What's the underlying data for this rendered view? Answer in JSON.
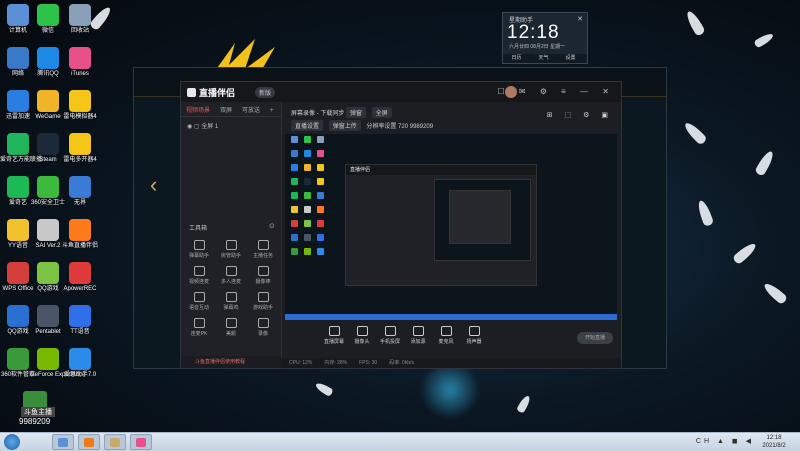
{
  "desktop_icons": [
    {
      "label": "计算机",
      "color": "#5b8fd6"
    },
    {
      "label": "微信",
      "color": "#2dc34a"
    },
    {
      "label": "回收站",
      "color": "#8aa0b8"
    },
    {
      "label": "网络",
      "color": "#3a78c8"
    },
    {
      "label": "腾讯QQ",
      "color": "#1e88e5"
    },
    {
      "label": "iTunes",
      "color": "#e8508a"
    },
    {
      "label": "迅雷加速",
      "color": "#2a7de1"
    },
    {
      "label": "WeGame",
      "color": "#f0b428"
    },
    {
      "label": "雷电模拟器4",
      "color": "#f5c518"
    },
    {
      "label": "爱奇艺万能联播",
      "color": "#20b55a"
    },
    {
      "label": "Steam",
      "color": "#1b2838"
    },
    {
      "label": "雷电多开器4",
      "color": "#f5c518"
    },
    {
      "label": "爱奇艺",
      "color": "#1db954"
    },
    {
      "label": "360安全卫士",
      "color": "#3cba3c"
    },
    {
      "label": "无界",
      "color": "#3a7bd5"
    },
    {
      "label": "YY语音",
      "color": "#f2c22e"
    },
    {
      "label": "SAI Ver.2",
      "color": "#c8c8c8"
    },
    {
      "label": "斗鱼直播伴侣",
      "color": "#ff7a1a"
    },
    {
      "label": "WPS Office",
      "color": "#d43f3a"
    },
    {
      "label": "QQ游戏",
      "color": "#7cc343"
    },
    {
      "label": "ApowerREC",
      "color": "#e03a3a"
    },
    {
      "label": "QQ游戏",
      "color": "#2a6fd1"
    },
    {
      "label": "Pentablet",
      "color": "#4a5568"
    },
    {
      "label": "TT语音",
      "color": "#2f6fea"
    },
    {
      "label": "360软件管家",
      "color": "#3a9a3a"
    },
    {
      "label": "GeForce Experience",
      "color": "#76b900"
    },
    {
      "label": "爱思助手7.0",
      "color": "#2b8be8"
    }
  ],
  "clock_widget": {
    "tag": "星期助手",
    "time": "12:18",
    "sub": "六月廿四  08月2日  星期一",
    "bottom": [
      "日历",
      "天气",
      "设置"
    ]
  },
  "app": {
    "name": "直播伴侣",
    "badge": "新版",
    "tabs": [
      "视频场景",
      "双屏",
      "可放送"
    ],
    "scene_item": "全屏 1",
    "tools_title": "工具箱",
    "tools": [
      "弹幕助手",
      "房管助手",
      "主播任务",
      "视频连麦",
      "多人连麦",
      "摄像棒",
      "语音互动",
      "弹幕鸡",
      "游戏助手",
      "连麦PK",
      "美颜",
      "录像"
    ],
    "left_footer": "斗鱼直播伴侣使用教程",
    "toolbar_row1": [
      "屏幕录像 - 下载同步",
      "弹窗",
      "全屏"
    ],
    "toolbar_row2": [
      "直播设置",
      "弹窗上传",
      "分辨率设置 720",
      "9989209"
    ],
    "bottom_buttons": [
      "直播屏幕",
      "摄像头",
      "手机投屏",
      "添加源",
      "麦克风",
      "扬声器"
    ],
    "start_live": "开始直播",
    "status": [
      "CPU: 12%",
      "内存: 28%",
      "FPS: 30",
      "码率: 0kb/s"
    ]
  },
  "nested_app_title": "直播伴侣",
  "zjian": {
    "id": "9989209",
    "name": "斗鱼主播"
  },
  "taskbar": {
    "buttons": [
      "#5b8fd6",
      "#f07a1a",
      "#c8aa6e",
      "#e8508a"
    ],
    "tray": "CH ▲ ◼ ◀",
    "time": "12:18",
    "date": "2021/8/2"
  }
}
